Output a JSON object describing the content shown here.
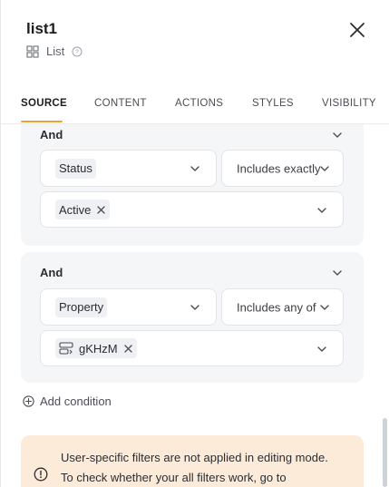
{
  "header": {
    "title": "list1",
    "component_type": "List",
    "help_icon": "question-circle-icon"
  },
  "tabs": [
    {
      "label": "SOURCE",
      "active": true
    },
    {
      "label": "CONTENT",
      "active": false
    },
    {
      "label": "ACTIONS",
      "active": false
    },
    {
      "label": "STYLES",
      "active": false
    },
    {
      "label": "VISIBILITY",
      "active": false
    }
  ],
  "filters": {
    "group1": {
      "label": "And",
      "field": "Status",
      "operator": "Includes exactly",
      "values": [
        "Active"
      ]
    },
    "group2": {
      "label": "And",
      "field": "Property",
      "operator": "Includes any of",
      "values": [
        "gKHzM"
      ]
    },
    "add_condition_label": "Add condition"
  },
  "notice": {
    "line1": "User-specific filters are not applied in editing mode.",
    "line2": "To check whether your all filters work, go to"
  },
  "colors": {
    "accent": "#e8a33a",
    "notice_bg": "#fcebd9",
    "group_bg": "#f5f6f7"
  }
}
